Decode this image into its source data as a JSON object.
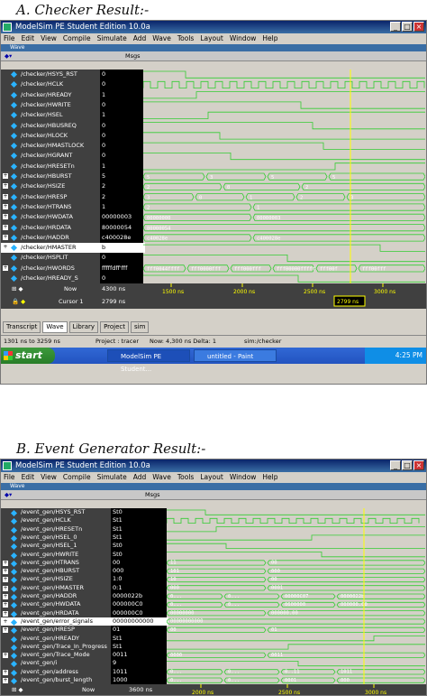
{
  "captionA": "A.   Checker Result:-",
  "captionB": "B.   Event Generator Result:-",
  "panelA": {
    "title": "ModelSim PE Student Edition 10.0a",
    "menus": [
      "File",
      "Edit",
      "View",
      "Compile",
      "Simulate",
      "Add",
      "Wave",
      "Tools",
      "Layout",
      "Window",
      "Help"
    ],
    "subtitle": "Wave",
    "msgs": "Msgs",
    "signals": [
      {
        "name": "/checker/HSYS_RST",
        "value": "0",
        "exp": false
      },
      {
        "name": "/checker/HCLK",
        "value": "0",
        "exp": false
      },
      {
        "name": "/checker/HREADY",
        "value": "1",
        "exp": false
      },
      {
        "name": "/checker/HWRITE",
        "value": "0",
        "exp": false
      },
      {
        "name": "/checker/HSEL",
        "value": "1",
        "exp": false
      },
      {
        "name": "/checker/HBUSREQ",
        "value": "0",
        "exp": false
      },
      {
        "name": "/checker/HLOCK",
        "value": "0",
        "exp": false
      },
      {
        "name": "/checker/HMASTLOCK",
        "value": "0",
        "exp": false
      },
      {
        "name": "/checker/HGRANT",
        "value": "0",
        "exp": false
      },
      {
        "name": "/checker/HRESETn",
        "value": "1",
        "exp": false
      },
      {
        "name": "/checker/HBURST",
        "value": "5",
        "exp": true
      },
      {
        "name": "/checker/HSIZE",
        "value": "2",
        "exp": true
      },
      {
        "name": "/checker/HRESP",
        "value": "2",
        "exp": true
      },
      {
        "name": "/checker/HTRANS",
        "value": "1",
        "exp": true
      },
      {
        "name": "/checker/HWDATA",
        "value": "00000003",
        "exp": true
      },
      {
        "name": "/checker/HRDATA",
        "value": "80000054",
        "exp": true
      },
      {
        "name": "/checker/HADDR",
        "value": "c400028e",
        "exp": true
      },
      {
        "name": "/checker/HMASTER",
        "value": "b",
        "exp": true,
        "sel": true
      },
      {
        "name": "/checker/HSPLIT",
        "value": "0",
        "exp": false
      },
      {
        "name": "/checker/HWORDS",
        "value": "fffffdff'fff",
        "exp": true
      },
      {
        "name": "/checker/HREADY_S",
        "value": "0",
        "exp": false
      }
    ],
    "wavelabels": [
      {
        "row": 10,
        "segs": [
          "5",
          "3",
          "5",
          "5"
        ]
      },
      {
        "row": 11,
        "segs": [
          "2",
          "0",
          "2"
        ]
      },
      {
        "row": 12,
        "segs": [
          "3",
          "0",
          "1",
          "2",
          "3"
        ]
      },
      {
        "row": 13,
        "segs": [
          "2",
          "1"
        ]
      },
      {
        "row": 14,
        "segs": [
          "00000000",
          "00000003"
        ]
      },
      {
        "row": 15,
        "segs": [
          "80000054"
        ]
      },
      {
        "row": 16,
        "segs": [
          "c40028e",
          "c400028e"
        ]
      },
      {
        "row": 19,
        "segs": [
          "fff0044ffff",
          "fff0000fff",
          "fff000fff",
          "fff00000fffff",
          "fff00f",
          "fff00fff"
        ]
      }
    ],
    "now_label": "Now",
    "now_value": "4300 ns",
    "cursor_label": "Cursor 1",
    "cursor_value": "2799 ns",
    "cursor_marker": "2799 ns",
    "ticks": [
      "1500 ns",
      "2000 ns",
      "2500 ns",
      "3000 ns"
    ],
    "tabs": [
      "Transcript",
      "Wave",
      "Library",
      "Project",
      "sim"
    ],
    "status": {
      "range": "1301 ns to 3259 ns",
      "project": "Project : tracer",
      "now": "Now: 4,300 ns  Delta: 1",
      "path": "sim:/checker"
    },
    "taskbar": {
      "start": "start",
      "items": [
        "ModelSim PE Student...",
        "untitled - Paint"
      ],
      "time": "4:25 PM"
    }
  },
  "panelB": {
    "title": "ModelSim PE Student Edition 10.0a",
    "menus": [
      "File",
      "Edit",
      "View",
      "Compile",
      "Simulate",
      "Add",
      "Wave",
      "Tools",
      "Layout",
      "Window",
      "Help"
    ],
    "subtitle": "Wave",
    "msgs": "Msgs",
    "signals": [
      {
        "name": "/event_gen/HSYS_RST",
        "value": "St0",
        "exp": false
      },
      {
        "name": "/event_gen/HCLK",
        "value": "St1",
        "exp": false
      },
      {
        "name": "/event_gen/HRESETn",
        "value": "St1",
        "exp": false
      },
      {
        "name": "/event_gen/HSEL_0",
        "value": "St1",
        "exp": false
      },
      {
        "name": "/event_gen/HSEL_1",
        "value": "St0",
        "exp": false
      },
      {
        "name": "/event_gen/HWRITE",
        "value": "St0",
        "exp": false
      },
      {
        "name": "/event_gen/HTRANS",
        "value": "00",
        "exp": true
      },
      {
        "name": "/event_gen/HBURST",
        "value": "000",
        "exp": true
      },
      {
        "name": "/event_gen/HSIZE",
        "value": "1:0",
        "exp": true
      },
      {
        "name": "/event_gen/HMASTER",
        "value": "0:1",
        "exp": true
      },
      {
        "name": "/event_gen/HADDR",
        "value": "0000022b",
        "exp": true
      },
      {
        "name": "/event_gen/HWDATA",
        "value": "000000C0",
        "exp": true
      },
      {
        "name": "/event_gen/HRDATA",
        "value": "000000C0",
        "exp": true
      },
      {
        "name": "/event_gen/error_signals",
        "value": "00000000000",
        "exp": true,
        "sel": true
      },
      {
        "name": "/event_gen/HRESP",
        "value": "01",
        "exp": true
      },
      {
        "name": "/event_gen/HREADY",
        "value": "St1",
        "exp": false
      },
      {
        "name": "/event_gen/Trace_In_Progress",
        "value": "St1",
        "exp": false
      },
      {
        "name": "/event_gen/Trace_Mode",
        "value": "0011",
        "exp": true
      },
      {
        "name": "/event_gen/i",
        "value": "9",
        "exp": false
      },
      {
        "name": "/event_gen/address",
        "value": "1011",
        "exp": true
      },
      {
        "name": "/event_gen/burst_length",
        "value": "1000",
        "exp": true
      }
    ],
    "wavelabels": [
      {
        "row": 6,
        "segs": [
          "11",
          "00"
        ]
      },
      {
        "row": 7,
        "segs": [
          "101",
          "000"
        ]
      },
      {
        "row": 8,
        "segs": [
          "10",
          "00"
        ]
      },
      {
        "row": 9,
        "segs": [
          "000",
          "0001"
        ]
      },
      {
        "row": 10,
        "segs": [
          "0...",
          "0...",
          "00000C07",
          "0000022b"
        ]
      },
      {
        "row": 11,
        "segs": [
          "0...",
          "0...",
          "0600000",
          "000000.00"
        ]
      },
      {
        "row": 12,
        "segs": [
          "00000000",
          "000000.00"
        ]
      },
      {
        "row": 13,
        "segs": [
          "00000000000"
        ]
      },
      {
        "row": 14,
        "segs": [
          "00",
          "01"
        ]
      },
      {
        "row": 17,
        "segs": [
          "0000",
          "0011"
        ]
      },
      {
        "row": 19,
        "segs": [
          "0...",
          "0...",
          "0..11",
          "1011"
        ]
      },
      {
        "row": 20,
        "segs": [
          "0...",
          "0...",
          "0001",
          "000"
        ]
      }
    ],
    "now_label": "Now",
    "now_value": "3600 ns",
    "ticks": [
      "2000 ns",
      "2500 ns",
      "3000 ns"
    ]
  }
}
